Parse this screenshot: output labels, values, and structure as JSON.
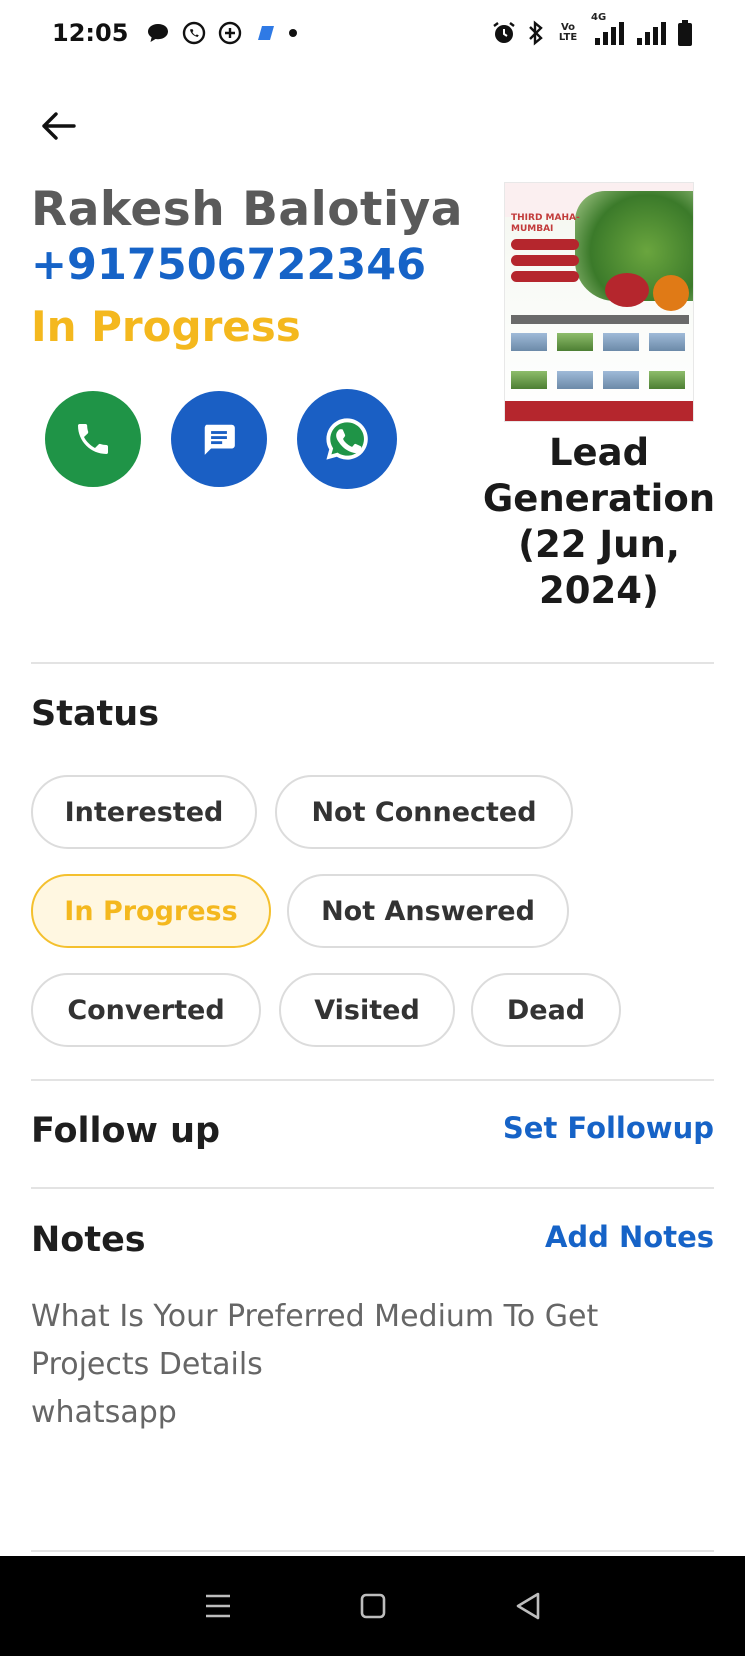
{
  "status_bar": {
    "time": "12:05",
    "left_icons": [
      "chat-bubble-icon",
      "whatsapp-icon",
      "sync-icon",
      "app-icon",
      "dot-icon"
    ],
    "right_icons": [
      "alarm-icon",
      "bluetooth-icon",
      "volte-icon",
      "4g-signal-icon",
      "signal-icon",
      "battery-icon"
    ],
    "volte_label": "Vo LTE",
    "network_label": "4G"
  },
  "lead": {
    "name": "Rakesh Balotiya",
    "phone": "+917506722346",
    "status": "In Progress"
  },
  "actions": [
    "call-icon",
    "message-icon",
    "whatsapp-icon"
  ],
  "flyer": {
    "title": "THIRD MAHA-MUMBAI",
    "caption": "Lead Generation (22 Jun, 2024)"
  },
  "status_section": {
    "title": "Status",
    "options": [
      "Interested",
      "Not Connected",
      "In Progress",
      "Not Answered",
      "Converted",
      "Visited",
      "Dead"
    ],
    "selected": "In Progress"
  },
  "followup": {
    "title": "Follow up",
    "action_label": "Set Followup"
  },
  "notes": {
    "title": "Notes",
    "action_label": "Add Notes",
    "question": "What Is Your Preferred Medium To Get Projects Details",
    "answer": "whatsapp"
  },
  "colors": {
    "name": "#5a5a5a",
    "phone": "#1663c7",
    "status": "#f4b81e",
    "call": "#1f9447",
    "message": "#1a5fc4",
    "link": "#1663c7"
  },
  "nav": [
    "menu-icon",
    "home-icon",
    "back-triangle-icon"
  ]
}
